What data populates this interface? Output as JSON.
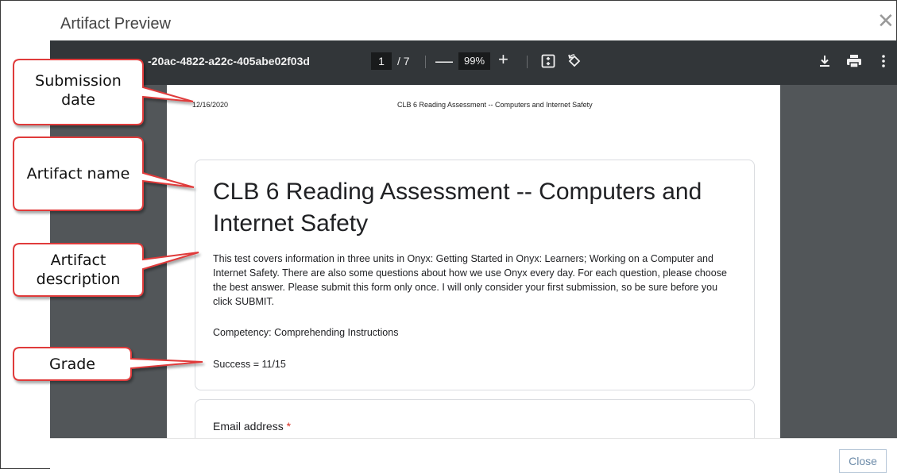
{
  "modal": {
    "title": "Artifact Preview",
    "close_icon": "close-icon",
    "close_button_label": "Close"
  },
  "toolbar": {
    "file_name": "-20ac-4822-a22c-405abe02f03d",
    "current_page": "1",
    "page_total": "/ 7",
    "zoom_out_label": "—",
    "zoom_level": "99%",
    "zoom_in_label": "+",
    "icons": [
      "fit-to-page-icon",
      "rotate-icon",
      "download-icon",
      "print-icon",
      "more-options-icon"
    ]
  },
  "document": {
    "date": "12/16/2020",
    "header": "CLB 6 Reading Assessment -- Computers and Internet Safety",
    "title": "CLB 6 Reading Assessment -- Computers and Internet Safety",
    "description": "This test covers information in three units in Onyx:  Getting Started in Onyx:  Learners; Working on a Computer and Internet Safety.  There are also some questions about how we use Onyx every day.  For each question, please choose the best answer.  Please submit this form only once.  I will only consider your first submission, so be sure before you click SUBMIT.",
    "competency": "Competency:  Comprehending Instructions",
    "grade": "Success = 11/15",
    "email_label": "Email address",
    "required_marker": "*"
  },
  "callouts": {
    "submission_date": [
      "Submission",
      "date"
    ],
    "artifact_name": "Artifact name",
    "artifact_description": [
      "Artifact",
      "description"
    ],
    "grade": "Grade"
  },
  "colors": {
    "callout_border": "#e03a3a",
    "viewer_background": "#525659",
    "toolbar_background": "#323639",
    "required_marker": "#d93025"
  }
}
